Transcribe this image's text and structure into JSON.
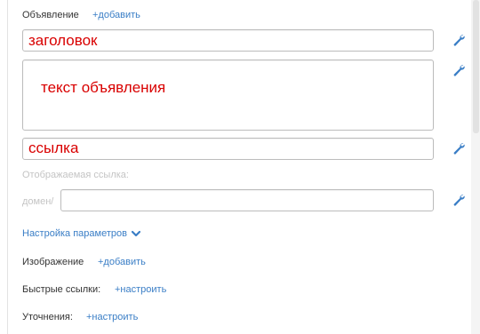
{
  "ad_section": {
    "label": "Объявление",
    "add_link": "+добавить"
  },
  "title_field": {
    "value": "заголовок"
  },
  "text_field": {
    "value": "текст объявления"
  },
  "link_field": {
    "value": "ссылка"
  },
  "display_link": {
    "label": "Отображаемая ссылка:",
    "prefix": "домен/",
    "value": ""
  },
  "settings": {
    "label": "Настройка параметров",
    "icon": "chevron-down-icon"
  },
  "image": {
    "label": "Изображение",
    "add_link": "+добавить"
  },
  "quick_links": {
    "label": "Быстрые ссылки:",
    "configure_link": "+настроить"
  },
  "refinements": {
    "label": "Уточнения:",
    "configure_link": "+настроить"
  },
  "colors": {
    "link": "#3a7ec6",
    "text_red": "#d90000",
    "icon": "#3a7ec6"
  }
}
